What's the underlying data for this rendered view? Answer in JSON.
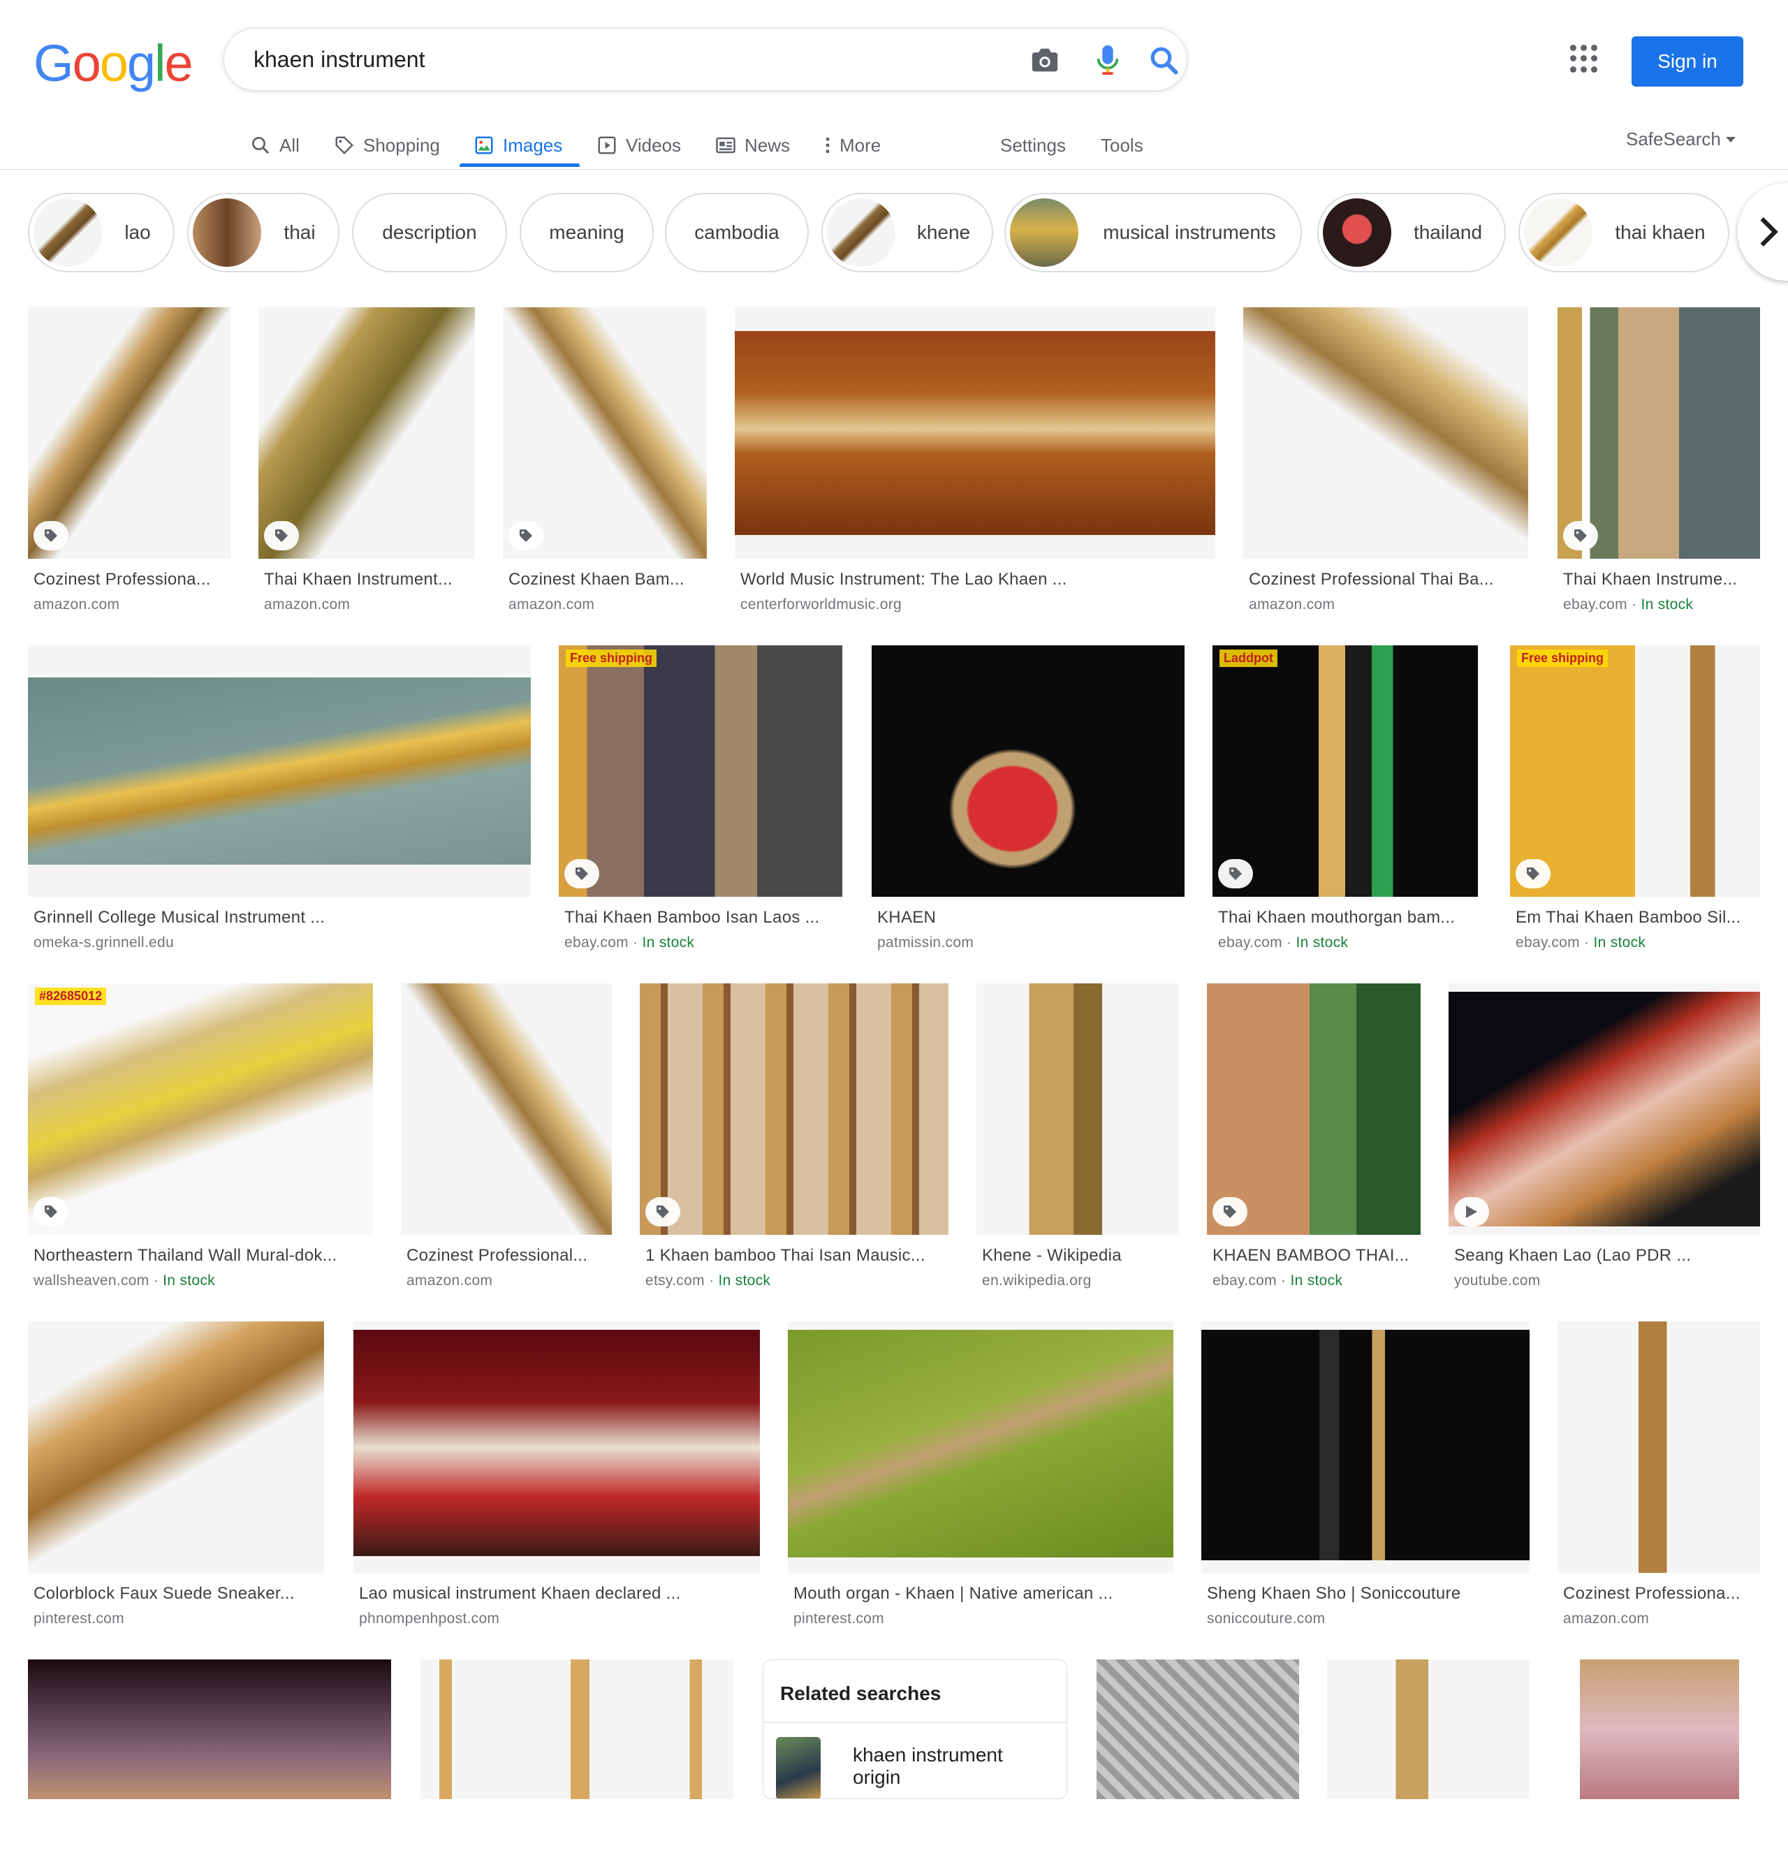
{
  "header": {
    "logo_text": "Google",
    "search_query": "khaen instrument",
    "signin_label": "Sign in"
  },
  "nav": {
    "tabs": [
      {
        "label": "All",
        "icon": "search-icon"
      },
      {
        "label": "Shopping",
        "icon": "tag-icon"
      },
      {
        "label": "Images",
        "icon": "image-icon",
        "active": true
      },
      {
        "label": "Videos",
        "icon": "play-icon"
      },
      {
        "label": "News",
        "icon": "news-icon"
      },
      {
        "label": "More",
        "icon": "more-vert-icon"
      }
    ],
    "settings": "Settings",
    "tools": "Tools",
    "safesearch": "SafeSearch"
  },
  "chips": [
    {
      "label": "lao"
    },
    {
      "label": "thai"
    },
    {
      "label": "description"
    },
    {
      "label": "meaning"
    },
    {
      "label": "cambodia"
    },
    {
      "label": "khene"
    },
    {
      "label": "musical instruments"
    },
    {
      "label": "thailand"
    },
    {
      "label": "thai khaen"
    }
  ],
  "results": [
    {
      "title": "Cozinest Professiona...",
      "source": "amazon.com",
      "badge": "tag"
    },
    {
      "title": "Thai Khaen Instrument...",
      "source": "amazon.com",
      "badge": "tag"
    },
    {
      "title": "Cozinest Khaen Bam...",
      "source": "amazon.com",
      "badge": "tag"
    },
    {
      "title": "World Music Instrument: The Lao Khaen ...",
      "source": "centerforworldmusic.org"
    },
    {
      "title": "Cozinest Professional Thai Ba...",
      "source": "amazon.com"
    },
    {
      "title": "Thai Khaen Instrume...",
      "source": "ebay.com",
      "stock": "In stock",
      "badge": "tag"
    },
    {
      "title": "Grinnell College Musical Instrument ...",
      "source": "omeka-s.grinnell.edu"
    },
    {
      "title": "Thai Khaen Bamboo Isan Laos ...",
      "source": "ebay.com",
      "stock": "In stock",
      "badge": "tag",
      "overlay": "Free shipping"
    },
    {
      "title": "KHAEN",
      "source": "patmissin.com"
    },
    {
      "title": "Thai Khaen mouthorgan bam...",
      "source": "ebay.com",
      "stock": "In stock",
      "badge": "tag",
      "overlay": "Laddpot"
    },
    {
      "title": "Em Thai Khaen Bamboo Sil...",
      "source": "ebay.com",
      "stock": "In stock",
      "badge": "tag",
      "overlay": "Free shipping"
    },
    {
      "title": "Northeastern Thailand Wall Mural-dok...",
      "source": "wallsheaven.com",
      "stock": "In stock",
      "badge": "tag",
      "overlay": "#82685012"
    },
    {
      "title": "Cozinest Professional...",
      "source": "amazon.com"
    },
    {
      "title": "1 Khaen bamboo Thai Isan Mausic...",
      "source": "etsy.com",
      "stock": "In stock",
      "badge": "tag"
    },
    {
      "title": "Khene - Wikipedia",
      "source": "en.wikipedia.org"
    },
    {
      "title": "KHAEN BAMBOO THAI...",
      "source": "ebay.com",
      "stock": "In stock",
      "badge": "tag"
    },
    {
      "title": "Seang Khaen Lao (Lao PDR ...",
      "source": "youtube.com",
      "badge": "play"
    },
    {
      "title": "Colorblock Faux Suede Sneaker...",
      "source": "pinterest.com"
    },
    {
      "title": "Lao musical instrument Khaen declared ...",
      "source": "phnompenhpost.com"
    },
    {
      "title": "Mouth organ - Khaen | Native american ...",
      "source": "pinterest.com"
    },
    {
      "title": "Sheng Khaen Sho | Soniccouture",
      "source": "soniccouture.com"
    },
    {
      "title": "Cozinest Professiona...",
      "source": "amazon.com"
    },
    {
      "title": "",
      "source": ""
    },
    {
      "title": "",
      "source": ""
    },
    {
      "title": "",
      "source": ""
    },
    {
      "title": "",
      "source": ""
    },
    {
      "title": "",
      "source": ""
    }
  ],
  "related": {
    "title": "Related searches",
    "items": [
      {
        "label": "khaen instrument origin"
      }
    ]
  },
  "colors": {
    "accent": "#1a73e8",
    "stock": "#188038",
    "text": "#202124",
    "muted": "#70757a"
  }
}
